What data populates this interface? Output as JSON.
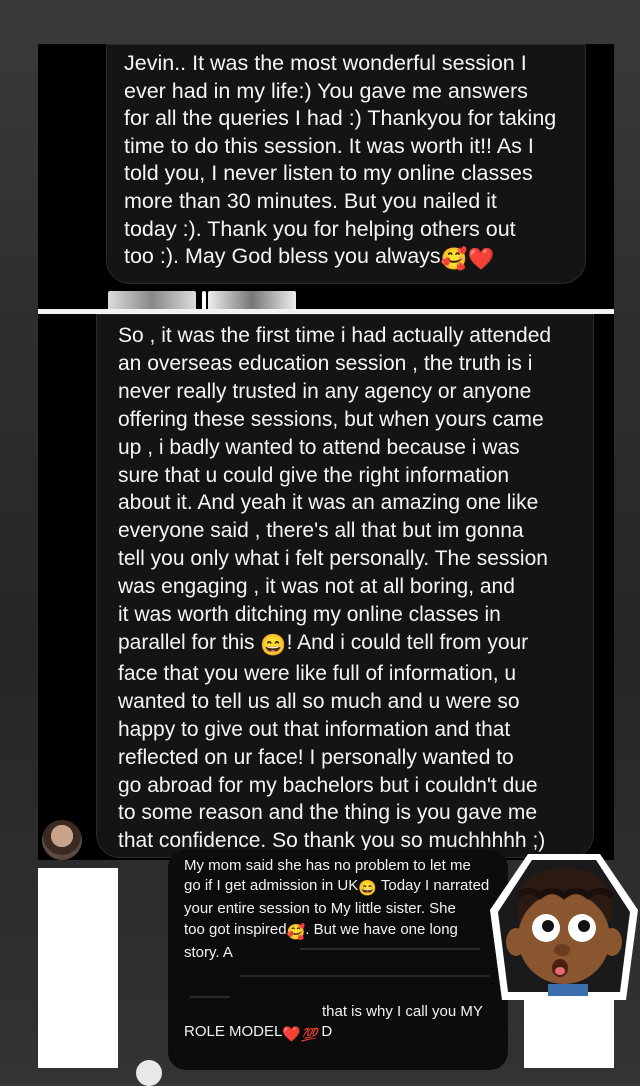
{
  "message1": {
    "text": "Jevin.. It was the most wonderful session I\never had in my life:) You gave me answers\nfor all the queries I had :) Thankyou for taking\ntime to do this session. It was worth it!! As I\ntold you, I never listen to my online classes\nmore than 30 minutes. But you nailed it\ntoday :). Thank you for helping others out\ntoo :). May God bless you always",
    "emojis": [
      "🥰",
      "❤️"
    ]
  },
  "message2": {
    "part1": "So , it was the first time i had actually attended\nan overseas education session , the truth is i\nnever really trusted in any agency or anyone\noffering these sessions, but when yours came\nup , i badly wanted to attend because i was\nsure that u could give the right information\nabout it. And yeah it was an amazing one like\neveryone said , there's all that but im gonna\ntell you only what i felt personally. The session\nwas engaging , it was not at all boring, and\nit was worth ditching my online classes in\nparallel for this ",
    "emoji": "😄",
    "part2": "! And i could tell from your\nface that you were like full of information, u\nwanted to tell us all so much and u were so\nhappy to give out that information and that\nreflected on ur face! I personally wanted to\ngo abroad for my bachelors but i couldn't due\nto some reason and the thing is you gave me\nthat confidence. So thank you so muchhhhh ;)"
  },
  "message3": {
    "line1": "My mom said she has no problem to let me",
    "line2a": "go if I get admission in UK",
    "emoji_a": "😄",
    "line2b": " Today I narrated",
    "line3": "your entire session to My little sister. She",
    "line4a": "too got inspired",
    "emoji_b": "🥰",
    "line4b": ". But we have one long",
    "line5": "story. A",
    "line6": "that is why I call you MY",
    "line7a": "ROLE MODEL",
    "emoji_c": "❤️",
    "emoji_d": "💯",
    "line7b": " D"
  },
  "icons": {
    "avatar": "user-avatar-icon",
    "character": "cartoon-character-sticker"
  }
}
